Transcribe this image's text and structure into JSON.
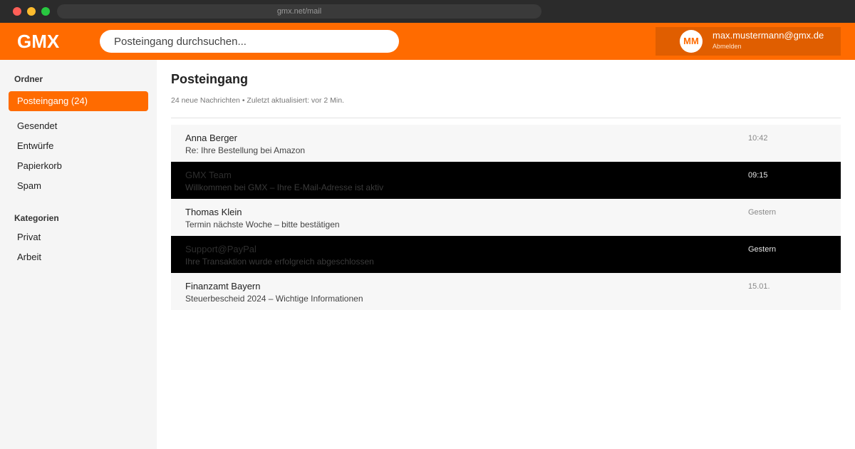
{
  "browser": {
    "url": "gmx.net/mail"
  },
  "header": {
    "logo": "GMX",
    "search_placeholder": "Posteingang durchsuchen...",
    "user": {
      "initials": "MM",
      "email": "max.mustermann@gmx.de",
      "logout": "Abmelden"
    }
  },
  "sidebar": {
    "folders_heading": "Ordner",
    "folders": [
      {
        "label": "Posteingang (24)",
        "active": true
      },
      {
        "label": "Gesendet"
      },
      {
        "label": "Entwürfe"
      },
      {
        "label": "Papierkorb"
      },
      {
        "label": "Spam"
      }
    ],
    "categories_heading": "Kategorien",
    "categories": [
      {
        "label": "Privat"
      },
      {
        "label": "Arbeit"
      }
    ]
  },
  "main": {
    "title": "Posteingang",
    "subtitle": "24 neue Nachrichten • Zuletzt aktualisiert: vor 2 Min.",
    "messages": [
      {
        "sender": "Anna Berger",
        "subject": "Re: Ihre Bestellung bei Amazon",
        "time": "10:42",
        "style": "normal"
      },
      {
        "sender": "GMX Team",
        "subject": "Willkommen bei GMX – Ihre E-Mail-Adresse ist aktiv",
        "time": "09:15",
        "style": "dark"
      },
      {
        "sender": "Thomas Klein",
        "subject": "Termin nächste Woche – bitte bestätigen",
        "time": "Gestern",
        "style": "normal"
      },
      {
        "sender": "Support@PayPal",
        "subject": "Ihre Transaktion wurde erfolgreich abgeschlossen",
        "time": "Gestern",
        "style": "dark"
      },
      {
        "sender": "Finanzamt Bayern",
        "subject": "Steuerbescheid 2024 – Wichtige Informationen",
        "time": "15.01.",
        "style": "normal"
      }
    ]
  },
  "colors": {
    "brand": "#ff6b00",
    "brand_dark": "#e05e00",
    "sidebar_bg": "#f5f5f5",
    "row_bg": "#f7f7f7",
    "highlight_row_bg": "#000000"
  }
}
